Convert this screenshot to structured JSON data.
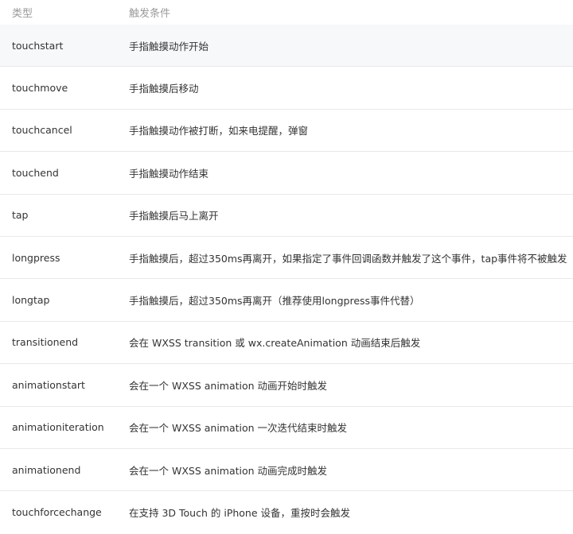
{
  "header": {
    "type": "类型",
    "condition": "触发条件"
  },
  "rows": [
    {
      "type": "touchstart",
      "condition": "手指触摸动作开始"
    },
    {
      "type": "touchmove",
      "condition": "手指触摸后移动"
    },
    {
      "type": "touchcancel",
      "condition": "手指触摸动作被打断，如来电提醒，弹窗"
    },
    {
      "type": "touchend",
      "condition": "手指触摸动作结束"
    },
    {
      "type": "tap",
      "condition": "手指触摸后马上离开"
    },
    {
      "type": "longpress",
      "condition": "手指触摸后，超过350ms再离开，如果指定了事件回调函数并触发了这个事件，tap事件将不被触发"
    },
    {
      "type": "longtap",
      "condition": "手指触摸后，超过350ms再离开（推荐使用longpress事件代替）"
    },
    {
      "type": "transitionend",
      "condition": "会在 WXSS transition 或 wx.createAnimation 动画结束后触发"
    },
    {
      "type": "animationstart",
      "condition": "会在一个 WXSS animation 动画开始时触发"
    },
    {
      "type": "animationiteration",
      "condition": "会在一个 WXSS animation 一次迭代结束时触发"
    },
    {
      "type": "animationend",
      "condition": "会在一个 WXSS animation 动画完成时触发"
    },
    {
      "type": "touchforcechange",
      "condition": "在支持 3D Touch 的 iPhone 设备，重按时会触发"
    }
  ]
}
